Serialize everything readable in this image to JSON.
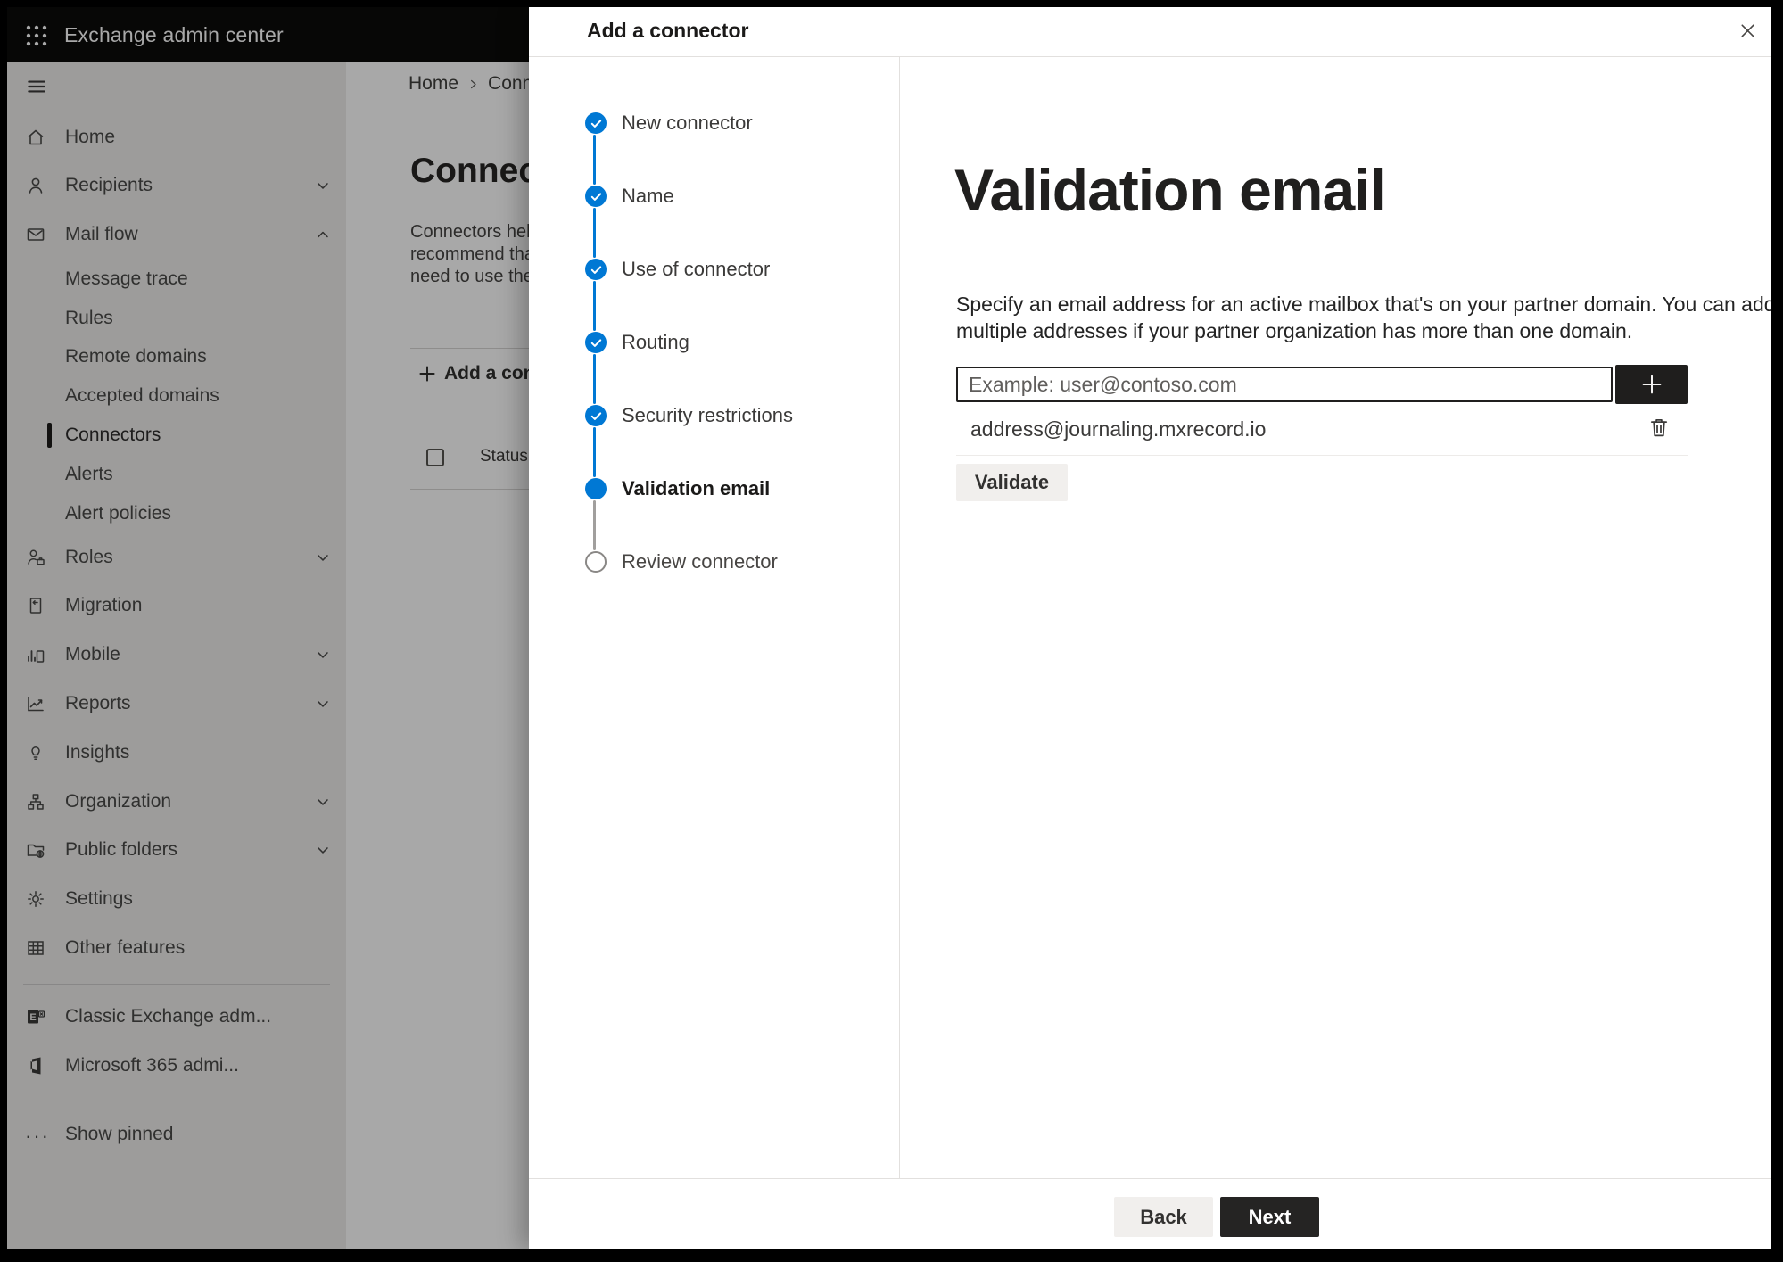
{
  "app_header": {
    "title": "Exchange admin center"
  },
  "breadcrumb": {
    "home": "Home",
    "current": "Conne"
  },
  "background_page": {
    "title": "Connec",
    "description_lines": [
      "Connectors help",
      "recommend that",
      "need to use ther"
    ],
    "add_connector_label": "Add a conn",
    "status_column": "Status"
  },
  "sidebar": {
    "items": [
      {
        "label": "Home"
      },
      {
        "label": "Recipients"
      },
      {
        "label": "Mail flow"
      },
      {
        "label": "Message trace"
      },
      {
        "label": "Rules"
      },
      {
        "label": "Remote domains"
      },
      {
        "label": "Accepted domains"
      },
      {
        "label": "Connectors",
        "selected": true
      },
      {
        "label": "Alerts"
      },
      {
        "label": "Alert policies"
      },
      {
        "label": "Roles"
      },
      {
        "label": "Migration"
      },
      {
        "label": "Mobile"
      },
      {
        "label": "Reports"
      },
      {
        "label": "Insights"
      },
      {
        "label": "Organization"
      },
      {
        "label": "Public folders"
      },
      {
        "label": "Settings"
      },
      {
        "label": "Other features"
      },
      {
        "label": "Classic Exchange adm..."
      },
      {
        "label": "Microsoft 365 admi..."
      },
      {
        "label": "Show pinned"
      }
    ]
  },
  "wizard": {
    "title": "Add a connector",
    "steps": [
      {
        "label": "New connector",
        "state": "done"
      },
      {
        "label": "Name",
        "state": "done"
      },
      {
        "label": "Use of connector",
        "state": "done"
      },
      {
        "label": "Routing",
        "state": "done"
      },
      {
        "label": "Security restrictions",
        "state": "done"
      },
      {
        "label": "Validation email",
        "state": "current"
      },
      {
        "label": "Review connector",
        "state": "upcoming"
      }
    ],
    "heading": "Validation email",
    "description_lines": [
      "Specify an email address for an active mailbox that's on your partner domain. You can add",
      "multiple addresses if your partner organization has more than one domain."
    ],
    "email_input": {
      "value": "",
      "placeholder": "Example: user@contoso.com"
    },
    "added_addresses": [
      "address@journaling.mxrecord.io"
    ],
    "validate_label": "Validate",
    "back_label": "Back",
    "next_label": "Next"
  },
  "icons": {
    "app_launcher": "waffle-grid",
    "menu": "hamburger",
    "step_done": "check",
    "add_address": "plus",
    "remove_address": "trash",
    "close_panel": "x",
    "show_pinned": "ellipsis"
  },
  "colors": {
    "accent_blue": "#0078d4",
    "dark_button": "#252423",
    "header_bg": "#0b0b0a",
    "sidebar_bg": "#eeedec",
    "upcoming_gray": "#8a8886"
  }
}
